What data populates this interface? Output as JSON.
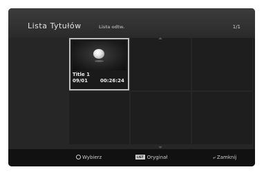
{
  "header": {
    "title": "Lista Tytułów",
    "subtitle": "Lista odtw.",
    "page_indicator": "1/1"
  },
  "titles": [
    {
      "name": "Title 1",
      "chapter": "09/01",
      "duration": "00:26:24"
    }
  ],
  "footer": {
    "select_icon": "select-circle-icon",
    "select_label": "Wybierz",
    "list_badge": "LIST",
    "list_label": "Oryginał",
    "close_icon": "return-icon",
    "close_label": "Zamknij"
  }
}
